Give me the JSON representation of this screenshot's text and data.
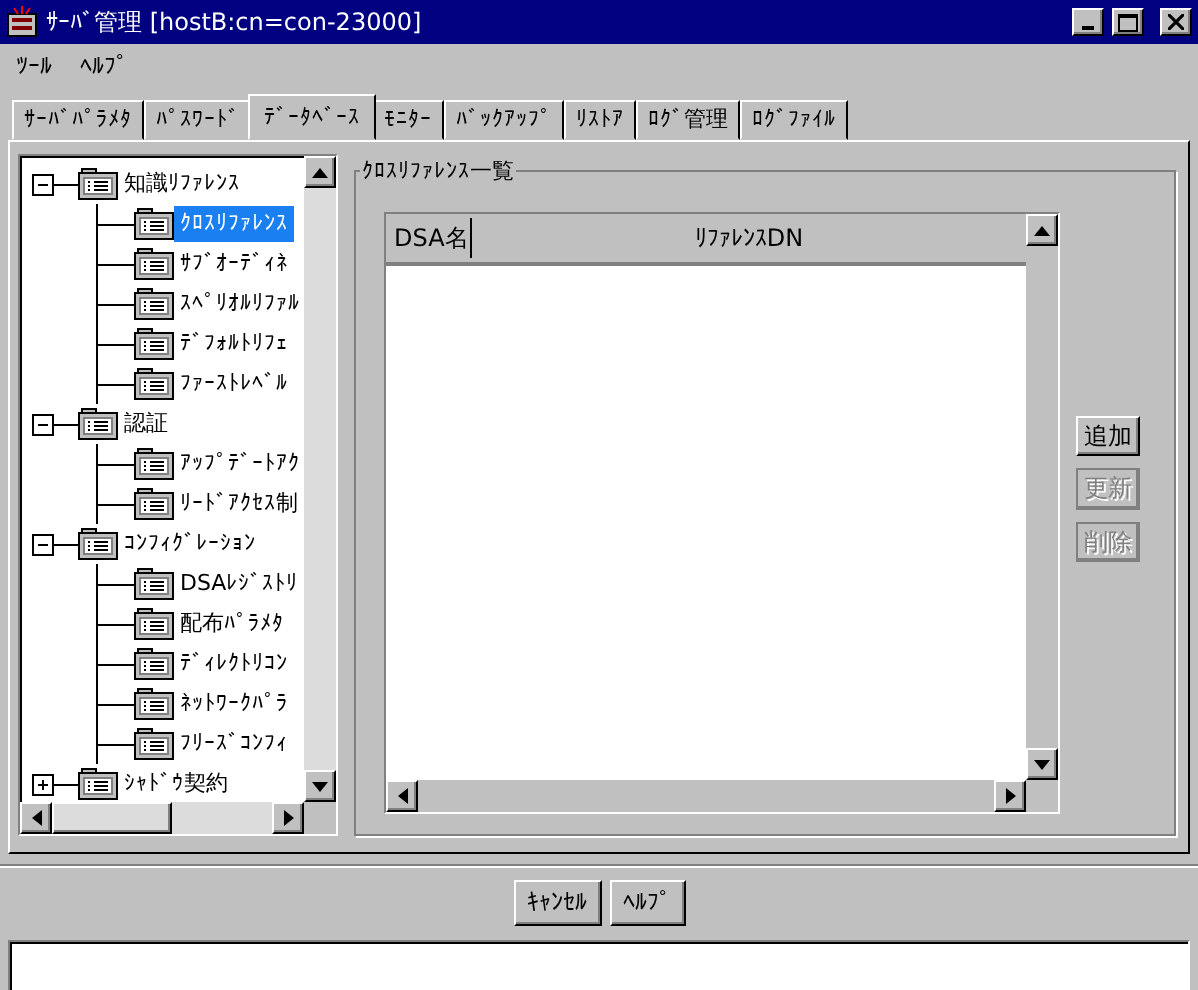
{
  "window": {
    "title": "ｻｰﾊﾞ管理 [hostB:cn=con-23000]"
  },
  "menu": [
    "ﾂｰﾙ",
    "ﾍﾙﾌﾟ"
  ],
  "tabs": [
    {
      "label": "ｻｰﾊﾞﾊﾟﾗﾒﾀ",
      "selected": false
    },
    {
      "label": "ﾊﾟｽﾜｰﾄﾞ",
      "selected": false
    },
    {
      "label": "ﾃﾞｰﾀﾍﾞｰｽ",
      "selected": true
    },
    {
      "label": "ﾓﾆﾀｰ",
      "selected": false
    },
    {
      "label": "ﾊﾞｯｸｱｯﾌﾟ",
      "selected": false
    },
    {
      "label": "ﾘｽﾄｱ",
      "selected": false
    },
    {
      "label": "ﾛｸﾞ管理",
      "selected": false
    },
    {
      "label": "ﾛｸﾞﾌｧｲﾙ",
      "selected": false
    }
  ],
  "tree": [
    {
      "label": "知識ﾘﾌｧﾚﾝｽ",
      "expanded": true,
      "selected": false,
      "children": [
        {
          "label": "ｸﾛｽﾘﾌｧﾚﾝｽ",
          "selected": true
        },
        {
          "label": "ｻﾌﾞｵｰﾃﾞｨﾈ",
          "selected": false
        },
        {
          "label": "ｽﾍﾟﾘｵﾙﾘﾌｧﾙ",
          "selected": false
        },
        {
          "label": "ﾃﾞﾌｫﾙﾄﾘﾌｪ",
          "selected": false
        },
        {
          "label": "ﾌｧｰｽﾄﾚﾍﾞﾙ",
          "selected": false
        }
      ]
    },
    {
      "label": "認証",
      "expanded": true,
      "selected": false,
      "children": [
        {
          "label": "ｱｯﾌﾟﾃﾞｰﾄｱｸ",
          "selected": false
        },
        {
          "label": "ﾘｰﾄﾞｱｸｾｽ制",
          "selected": false
        }
      ]
    },
    {
      "label": "ｺﾝﾌｨｸﾞﾚｰｼｮﾝ",
      "expanded": true,
      "selected": false,
      "children": [
        {
          "label": "DSAﾚｼﾞｽﾄﾘ",
          "selected": false
        },
        {
          "label": "配布ﾊﾟﾗﾒﾀ",
          "selected": false
        },
        {
          "label": "ﾃﾞｨﾚｸﾄﾘｺﾝ",
          "selected": false
        },
        {
          "label": "ﾈｯﾄﾜｰｸﾊﾟﾗ",
          "selected": false
        },
        {
          "label": "ﾌﾘｰｽﾞｺﾝﾌｨ",
          "selected": false
        }
      ]
    },
    {
      "label": "ｼｬﾄﾞｳ契約",
      "expanded": false,
      "selected": false
    }
  ],
  "group": {
    "title": "ｸﾛｽﾘﾌｧﾚﾝｽ一覧",
    "table": {
      "columns": [
        "DSA名",
        "ﾘﾌｧﾚﾝｽDN"
      ]
    },
    "buttons": [
      {
        "label": "追加",
        "disabled": false
      },
      {
        "label": "更新",
        "disabled": true
      },
      {
        "label": "削除",
        "disabled": true
      }
    ]
  },
  "footer_buttons": [
    "ｷｬﾝｾﾙ",
    "ﾍﾙﾌﾟ"
  ]
}
